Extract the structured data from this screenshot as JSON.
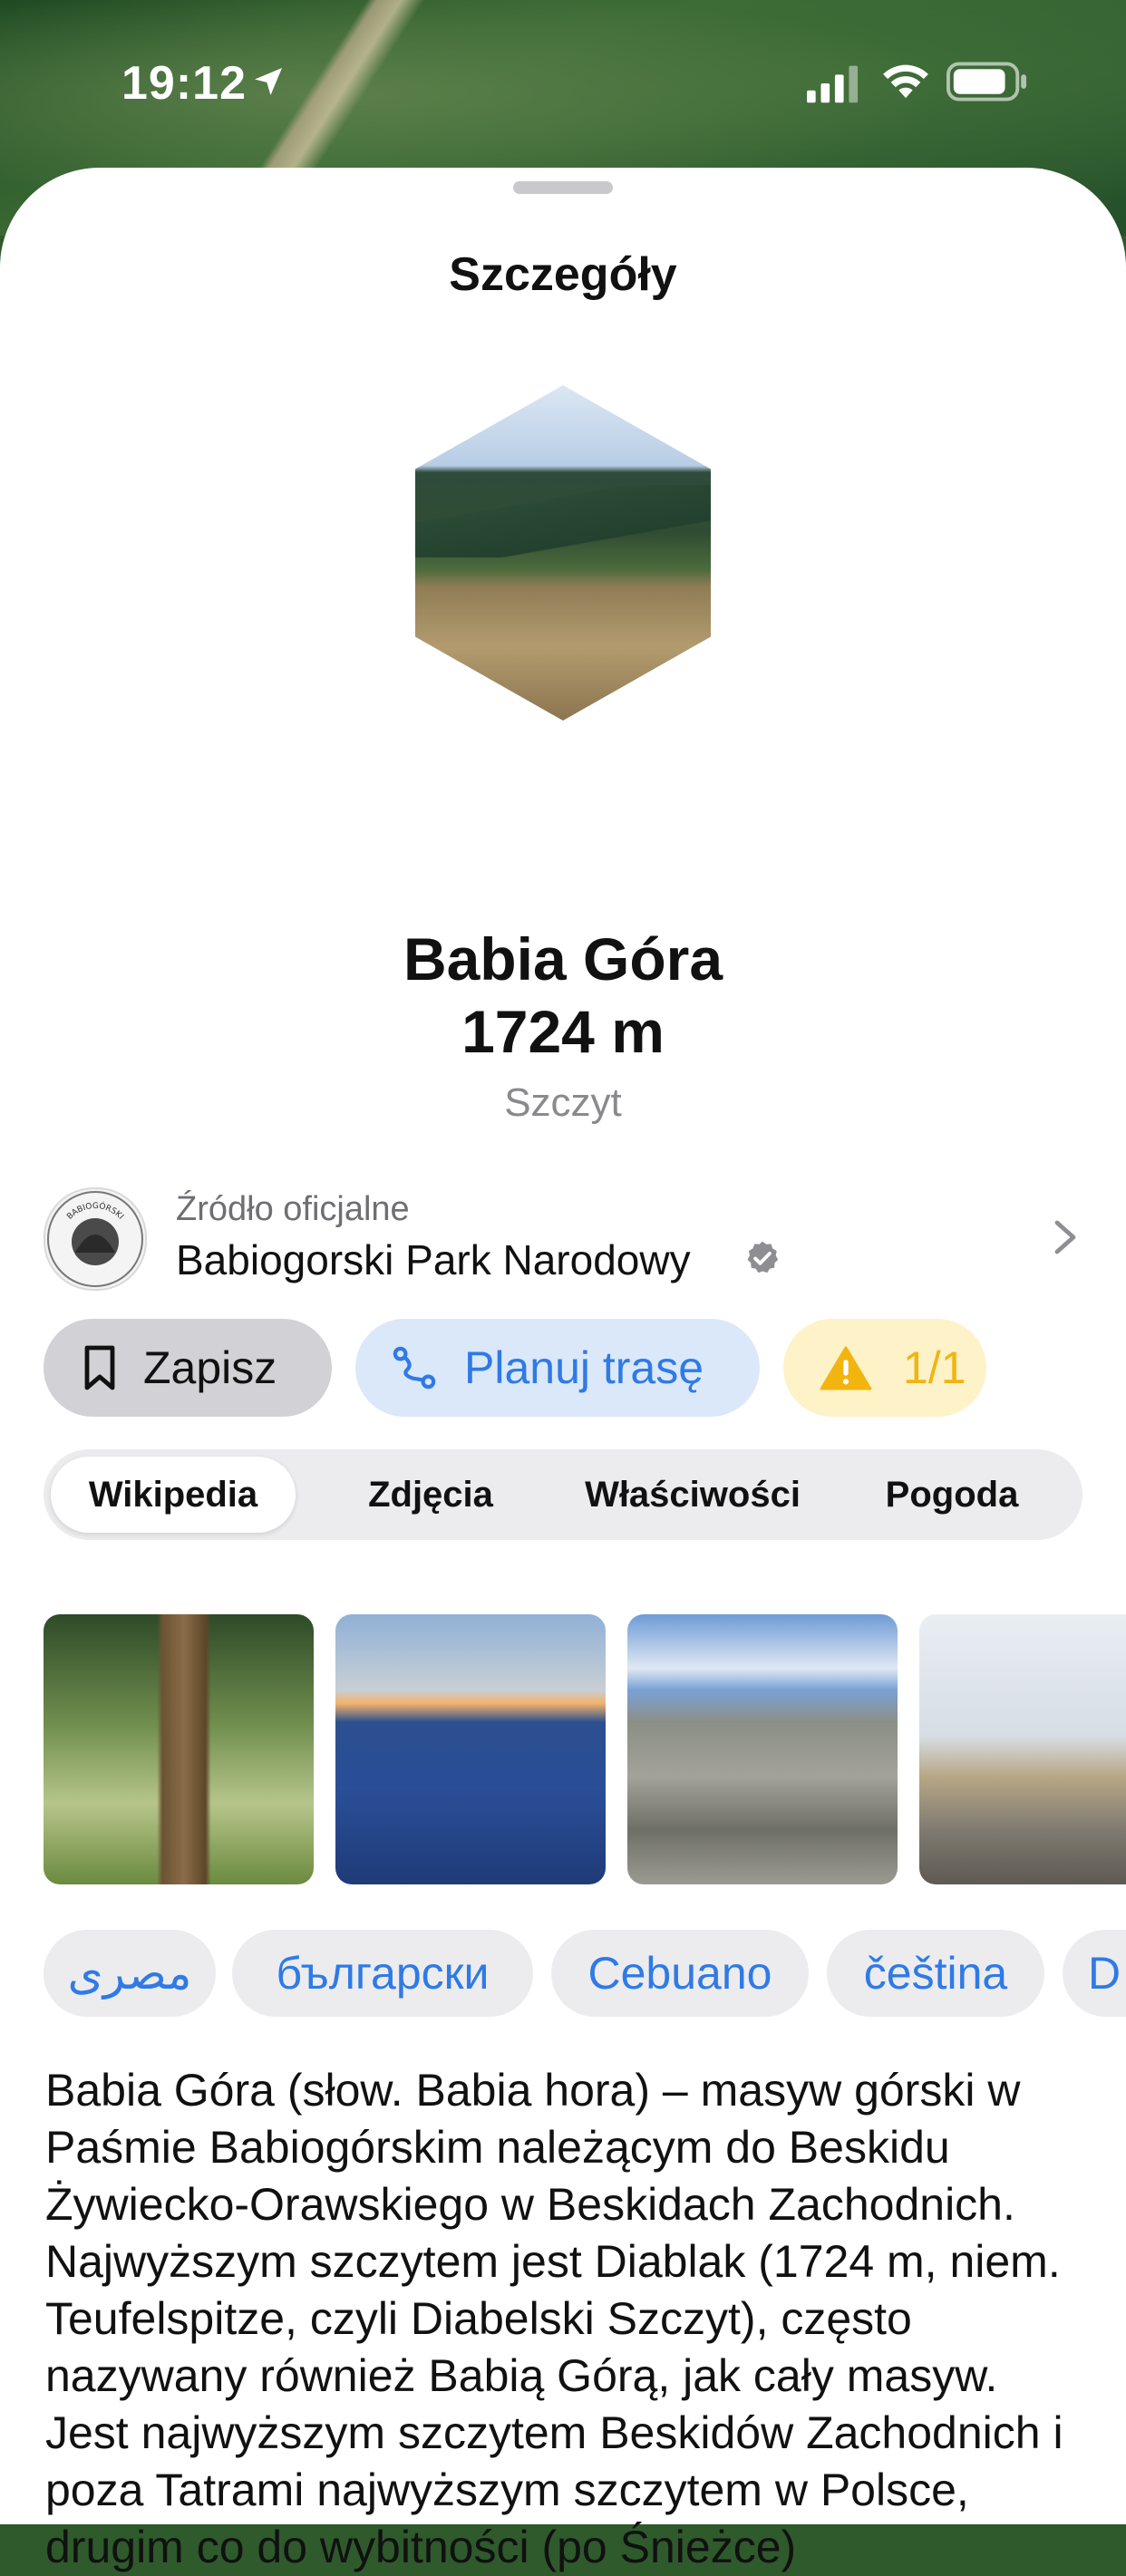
{
  "status_bar": {
    "time": "19:12"
  },
  "sheet": {
    "title": "Szczegóły"
  },
  "peak": {
    "name": "Babia Góra",
    "elevation": "1724 m",
    "type": "Szczyt"
  },
  "source": {
    "caption": "Źródło oficjalne",
    "name": "Babiogorski Park Narodowy",
    "logo_text": "BABIOGÓRSKI PARK NARODOWY"
  },
  "actions": {
    "save_label": "Zapisz",
    "route_label": "Planuj trasę",
    "alert_count": "1/1"
  },
  "tabs": [
    {
      "label": "Wikipedia",
      "active": true
    },
    {
      "label": "Zdjęcia",
      "active": false
    },
    {
      "label": "Właściwości",
      "active": false
    },
    {
      "label": "Pogoda",
      "active": false
    }
  ],
  "languages": [
    "مصرى",
    "български",
    "Cebuano",
    "čeština",
    "D"
  ],
  "article": {
    "text": "Babia Góra (słow. Babia hora) – masyw górski w Paśmie Babiogórskim należącym do Beskidu Żywiecko-Orawskiego w Beskidach Zachodnich. Najwyższym szczytem jest Diablak (1724 m, niem. Teufelspitze, czyli Diabelski Szczyt), często nazywany również Babią Górą, jak cały masyw. Jest najwyższym szczytem Beskidów Zachodnich i poza Tatrami najwyższym szczytem w Polsce, drugim co do wybitności (po Śnieżce)"
  },
  "colors": {
    "accent": "#2f7ae6",
    "warning": "#f2b40f",
    "sheet": "#ffffff"
  }
}
